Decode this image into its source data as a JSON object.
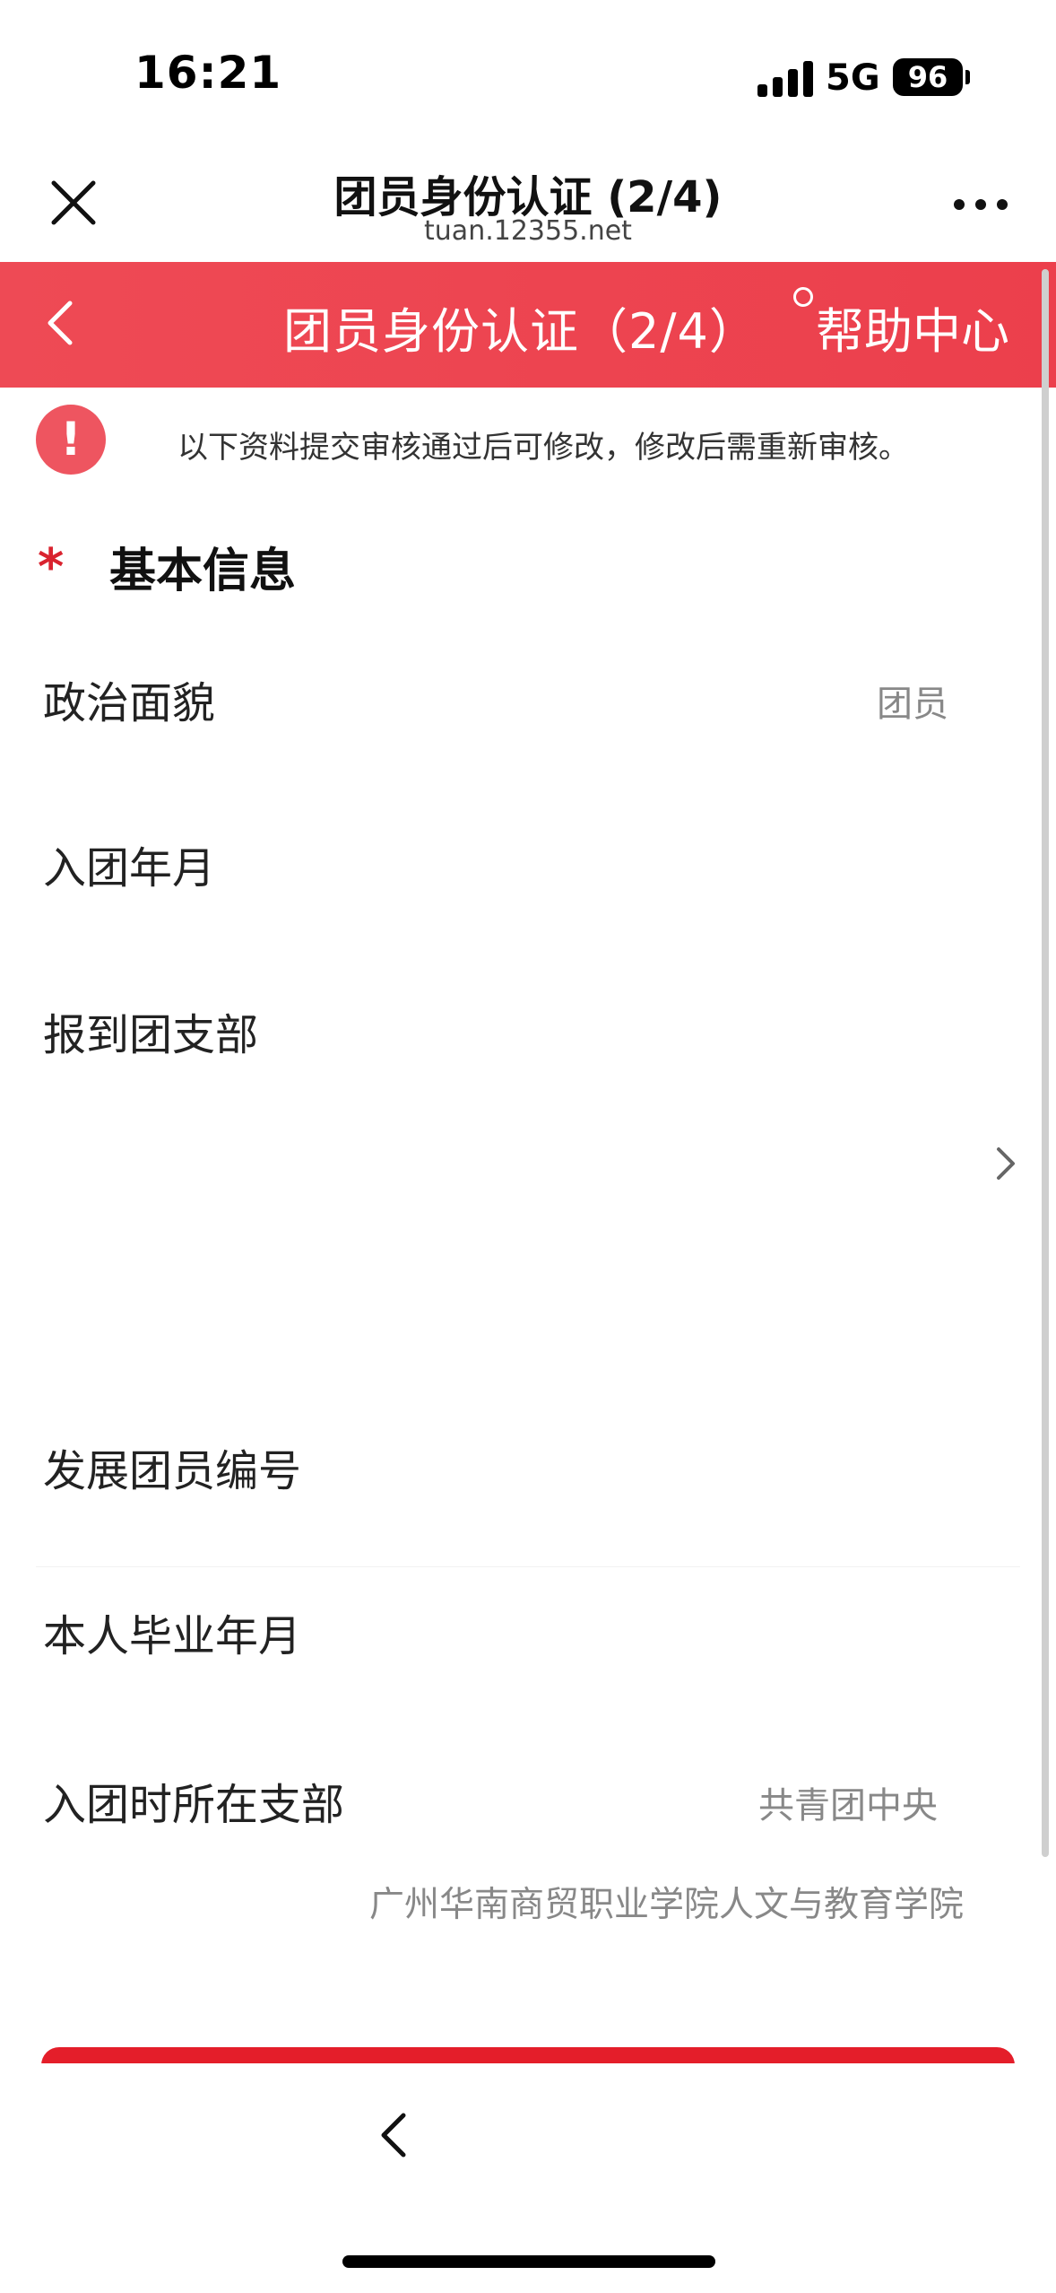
{
  "status_bar": {
    "time": "16:21",
    "network": "5G",
    "battery": "96",
    "signal_icon": "signal-bars-icon"
  },
  "browser": {
    "title": "团员身份认证 (2/4)",
    "domain": "tuan.12355.net",
    "close_icon": "close-icon",
    "more_icon": "more-icon"
  },
  "navbar": {
    "back_icon": "chevron-left-icon",
    "title": "团员身份认证（2/4）",
    "help_label": "帮助中心",
    "color": "#ee4a55"
  },
  "notice": {
    "icon": "!",
    "text": "以下资料提交审核通过后可修改，修改后需重新审核。"
  },
  "section": {
    "required_mark": "*",
    "title": "基本信息"
  },
  "form": {
    "political_status": {
      "label": "政治面貌",
      "value": "团员"
    },
    "join_date": {
      "label": "入团年月"
    },
    "branch": {
      "label": "报到团支部"
    },
    "member_number": {
      "label": "发展团员编号"
    },
    "graduation_date": {
      "label": "本人毕业年月"
    },
    "join_branch": {
      "label": "入团时所在支部",
      "value_line1": "共青团中央",
      "value_line2": "广州华南商贸职业学院人文与教育学院"
    }
  },
  "bottom": {
    "back_icon": "chevron-left-icon",
    "accent_color": "#e41e2a"
  }
}
